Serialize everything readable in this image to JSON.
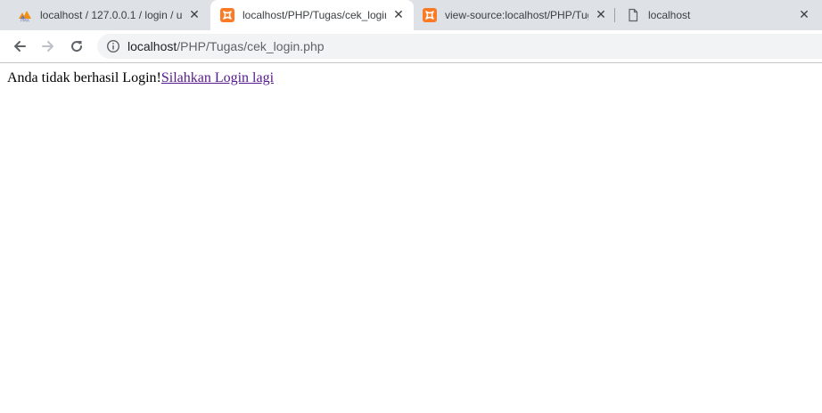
{
  "browser": {
    "tabs": [
      {
        "title": "localhost / 127.0.0.1 / login / u",
        "icon": "phpmyadmin-icon",
        "active": false
      },
      {
        "title": "localhost/PHP/Tugas/cek_login",
        "icon": "xampp-icon",
        "active": true
      },
      {
        "title": "view-source:localhost/PHP/Tug",
        "icon": "xampp-icon",
        "active": false
      },
      {
        "title": "localhost",
        "icon": "page-icon",
        "active": false
      }
    ],
    "close_glyph": "✕",
    "address": {
      "host": "localhost",
      "path": "/PHP/Tugas/cek_login.php"
    }
  },
  "page": {
    "message": "Anda tidak berhasil Login!",
    "link_text": "Silahkan Login lagi"
  },
  "colors": {
    "tabstrip": "#dee1e6",
    "active_tab": "#ffffff",
    "omnibox": "#f1f3f4",
    "visited_link": "#551a8b",
    "xampp_orange": "#fb7a24"
  }
}
